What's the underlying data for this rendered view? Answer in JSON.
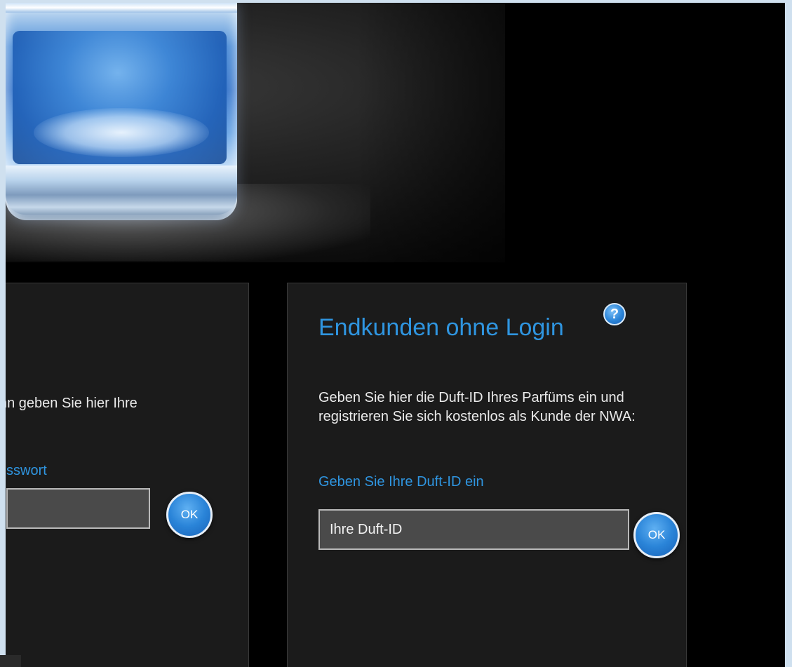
{
  "left_panel": {
    "text_fragment": "nn geben Sie hier Ihre",
    "password_label_fragment": "sswort",
    "ok_label": "OK"
  },
  "right_panel": {
    "title": "Endkunden ohne Login",
    "help_icon_glyph": "?",
    "description": "Geben Sie hier die Duft-ID Ihres Parfüms ein und registrieren Sie sich kostenlos als Kunde der NWA:",
    "field_label": "Geben Sie Ihre Duft-ID ein",
    "input_value": "Ihre Duft-ID",
    "ok_label": "OK"
  },
  "colors": {
    "accent_blue": "#2f95e0",
    "panel_bg": "#1b1b1b",
    "page_bg": "#000000"
  },
  "icons": {
    "help": "help-circle-icon",
    "hero": "perfume-glass-image"
  }
}
